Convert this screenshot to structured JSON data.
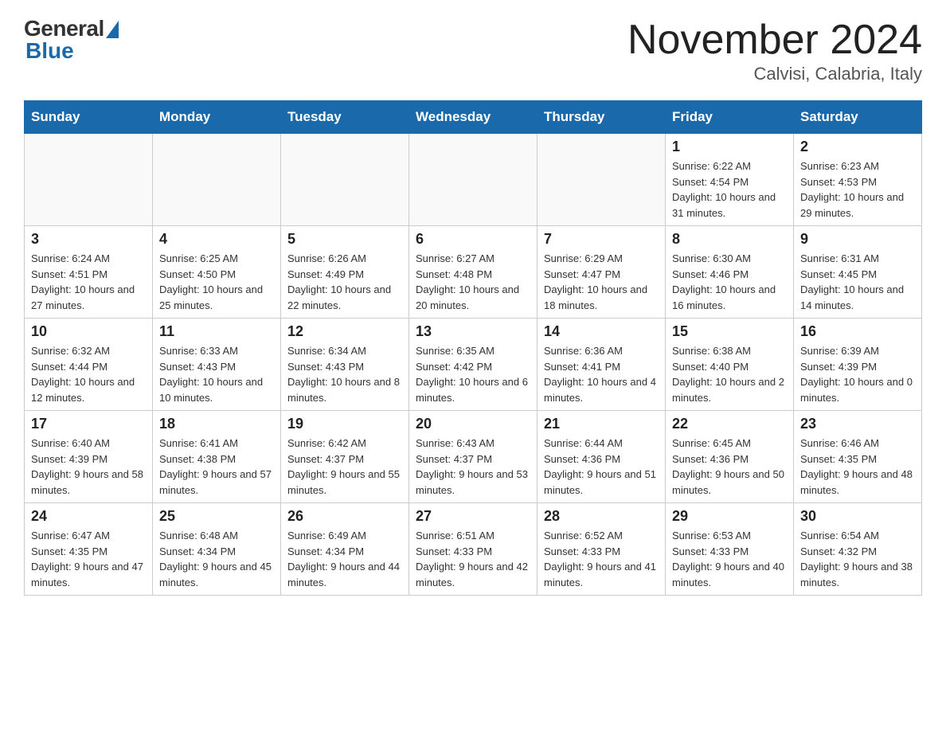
{
  "header": {
    "logo_general": "General",
    "logo_blue": "Blue",
    "month_title": "November 2024",
    "location": "Calvisi, Calabria, Italy"
  },
  "days_of_week": [
    "Sunday",
    "Monday",
    "Tuesday",
    "Wednesday",
    "Thursday",
    "Friday",
    "Saturday"
  ],
  "weeks": [
    [
      {
        "day": "",
        "info": ""
      },
      {
        "day": "",
        "info": ""
      },
      {
        "day": "",
        "info": ""
      },
      {
        "day": "",
        "info": ""
      },
      {
        "day": "",
        "info": ""
      },
      {
        "day": "1",
        "info": "Sunrise: 6:22 AM\nSunset: 4:54 PM\nDaylight: 10 hours and 31 minutes."
      },
      {
        "day": "2",
        "info": "Sunrise: 6:23 AM\nSunset: 4:53 PM\nDaylight: 10 hours and 29 minutes."
      }
    ],
    [
      {
        "day": "3",
        "info": "Sunrise: 6:24 AM\nSunset: 4:51 PM\nDaylight: 10 hours and 27 minutes."
      },
      {
        "day": "4",
        "info": "Sunrise: 6:25 AM\nSunset: 4:50 PM\nDaylight: 10 hours and 25 minutes."
      },
      {
        "day": "5",
        "info": "Sunrise: 6:26 AM\nSunset: 4:49 PM\nDaylight: 10 hours and 22 minutes."
      },
      {
        "day": "6",
        "info": "Sunrise: 6:27 AM\nSunset: 4:48 PM\nDaylight: 10 hours and 20 minutes."
      },
      {
        "day": "7",
        "info": "Sunrise: 6:29 AM\nSunset: 4:47 PM\nDaylight: 10 hours and 18 minutes."
      },
      {
        "day": "8",
        "info": "Sunrise: 6:30 AM\nSunset: 4:46 PM\nDaylight: 10 hours and 16 minutes."
      },
      {
        "day": "9",
        "info": "Sunrise: 6:31 AM\nSunset: 4:45 PM\nDaylight: 10 hours and 14 minutes."
      }
    ],
    [
      {
        "day": "10",
        "info": "Sunrise: 6:32 AM\nSunset: 4:44 PM\nDaylight: 10 hours and 12 minutes."
      },
      {
        "day": "11",
        "info": "Sunrise: 6:33 AM\nSunset: 4:43 PM\nDaylight: 10 hours and 10 minutes."
      },
      {
        "day": "12",
        "info": "Sunrise: 6:34 AM\nSunset: 4:43 PM\nDaylight: 10 hours and 8 minutes."
      },
      {
        "day": "13",
        "info": "Sunrise: 6:35 AM\nSunset: 4:42 PM\nDaylight: 10 hours and 6 minutes."
      },
      {
        "day": "14",
        "info": "Sunrise: 6:36 AM\nSunset: 4:41 PM\nDaylight: 10 hours and 4 minutes."
      },
      {
        "day": "15",
        "info": "Sunrise: 6:38 AM\nSunset: 4:40 PM\nDaylight: 10 hours and 2 minutes."
      },
      {
        "day": "16",
        "info": "Sunrise: 6:39 AM\nSunset: 4:39 PM\nDaylight: 10 hours and 0 minutes."
      }
    ],
    [
      {
        "day": "17",
        "info": "Sunrise: 6:40 AM\nSunset: 4:39 PM\nDaylight: 9 hours and 58 minutes."
      },
      {
        "day": "18",
        "info": "Sunrise: 6:41 AM\nSunset: 4:38 PM\nDaylight: 9 hours and 57 minutes."
      },
      {
        "day": "19",
        "info": "Sunrise: 6:42 AM\nSunset: 4:37 PM\nDaylight: 9 hours and 55 minutes."
      },
      {
        "day": "20",
        "info": "Sunrise: 6:43 AM\nSunset: 4:37 PM\nDaylight: 9 hours and 53 minutes."
      },
      {
        "day": "21",
        "info": "Sunrise: 6:44 AM\nSunset: 4:36 PM\nDaylight: 9 hours and 51 minutes."
      },
      {
        "day": "22",
        "info": "Sunrise: 6:45 AM\nSunset: 4:36 PM\nDaylight: 9 hours and 50 minutes."
      },
      {
        "day": "23",
        "info": "Sunrise: 6:46 AM\nSunset: 4:35 PM\nDaylight: 9 hours and 48 minutes."
      }
    ],
    [
      {
        "day": "24",
        "info": "Sunrise: 6:47 AM\nSunset: 4:35 PM\nDaylight: 9 hours and 47 minutes."
      },
      {
        "day": "25",
        "info": "Sunrise: 6:48 AM\nSunset: 4:34 PM\nDaylight: 9 hours and 45 minutes."
      },
      {
        "day": "26",
        "info": "Sunrise: 6:49 AM\nSunset: 4:34 PM\nDaylight: 9 hours and 44 minutes."
      },
      {
        "day": "27",
        "info": "Sunrise: 6:51 AM\nSunset: 4:33 PM\nDaylight: 9 hours and 42 minutes."
      },
      {
        "day": "28",
        "info": "Sunrise: 6:52 AM\nSunset: 4:33 PM\nDaylight: 9 hours and 41 minutes."
      },
      {
        "day": "29",
        "info": "Sunrise: 6:53 AM\nSunset: 4:33 PM\nDaylight: 9 hours and 40 minutes."
      },
      {
        "day": "30",
        "info": "Sunrise: 6:54 AM\nSunset: 4:32 PM\nDaylight: 9 hours and 38 minutes."
      }
    ]
  ]
}
